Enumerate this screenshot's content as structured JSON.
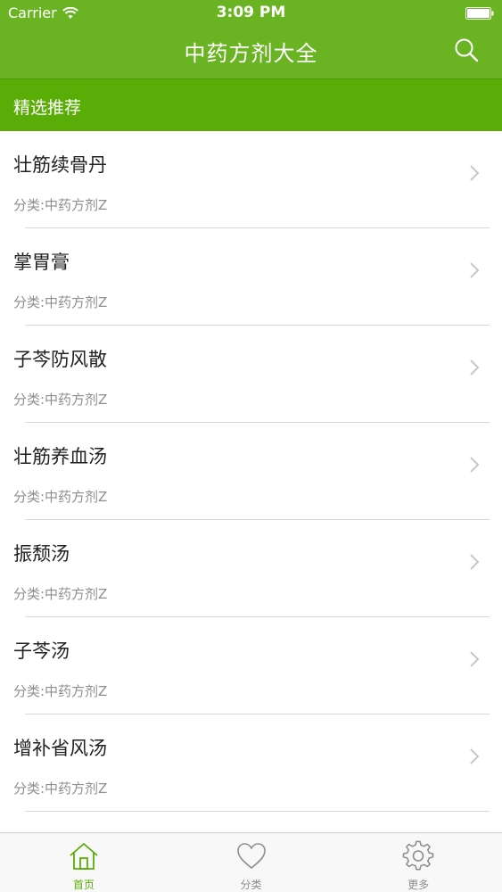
{
  "status_bar": {
    "carrier": "Carrier",
    "time": "3:09 PM"
  },
  "nav": {
    "title": "中药方剂大全",
    "search_icon": "search-icon"
  },
  "section": {
    "label": "精选推荐"
  },
  "list": {
    "items": [
      {
        "title": "壮筋续骨丹",
        "category": "分类:中药方剂Z"
      },
      {
        "title": "掌胃膏",
        "category": "分类:中药方剂Z"
      },
      {
        "title": "子芩防风散",
        "category": "分类:中药方剂Z"
      },
      {
        "title": "壮筋养血汤",
        "category": "分类:中药方剂Z"
      },
      {
        "title": "振颓汤",
        "category": "分类:中药方剂Z"
      },
      {
        "title": "子芩汤",
        "category": "分类:中药方剂Z"
      },
      {
        "title": "增补省风汤",
        "category": "分类:中药方剂Z"
      }
    ]
  },
  "tabbar": {
    "tabs": [
      {
        "label": "首页",
        "icon": "home-icon",
        "active": true
      },
      {
        "label": "分类",
        "icon": "heart-icon",
        "active": false
      },
      {
        "label": "更多",
        "icon": "gear-icon",
        "active": false
      }
    ]
  },
  "colors": {
    "nav_green": "#6ab423",
    "section_green": "#5aac06",
    "tab_active": "#5aac06",
    "tab_inactive": "#8e8e8e"
  }
}
